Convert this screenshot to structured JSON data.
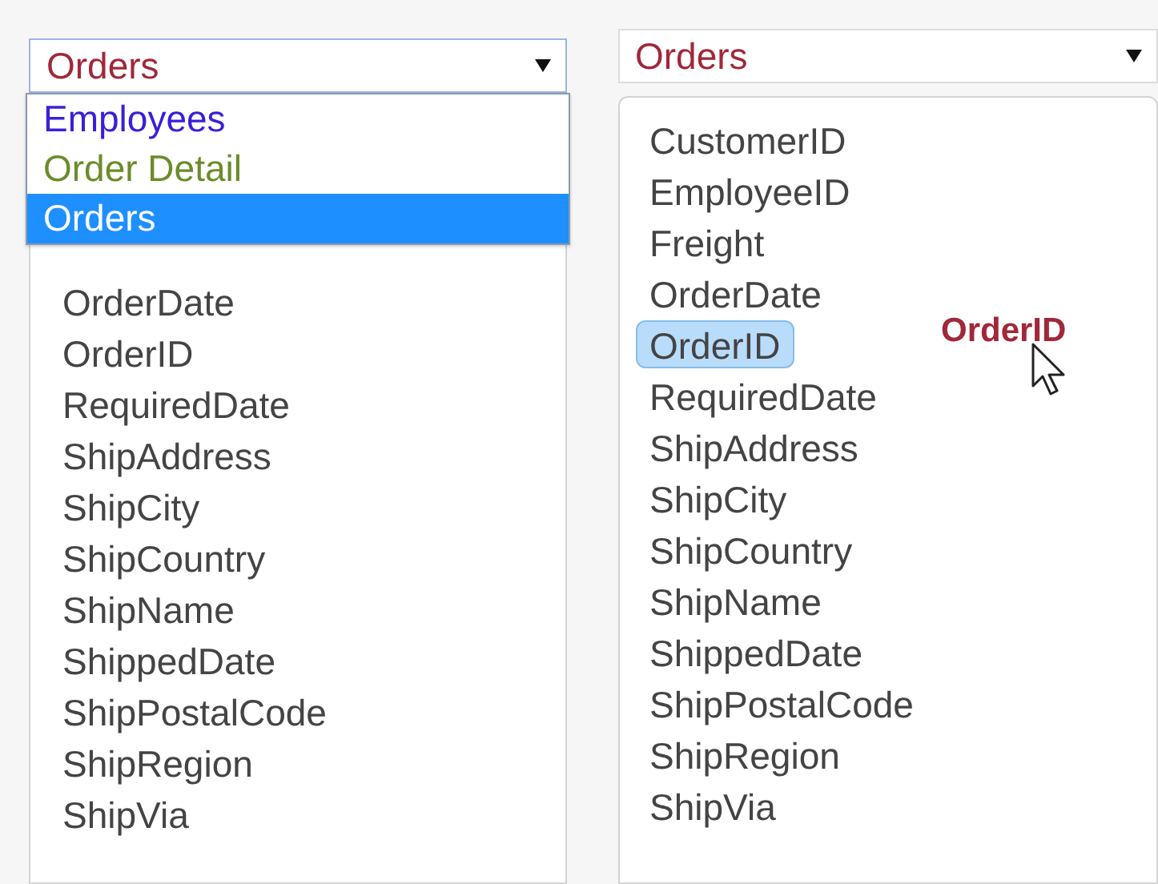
{
  "left_panel": {
    "select": {
      "value": "Orders",
      "expanded": true,
      "options": [
        {
          "label": "Employees",
          "color": "#3a1fd8",
          "selected": false
        },
        {
          "label": "Order Detail",
          "color": "#6b8c2a",
          "selected": false
        },
        {
          "label": "Orders",
          "selected": true
        }
      ]
    },
    "fields": [
      {
        "label": "OrderDate",
        "selected": false
      },
      {
        "label": "OrderID",
        "selected": false
      },
      {
        "label": "RequiredDate",
        "selected": false
      },
      {
        "label": "ShipAddress",
        "selected": false
      },
      {
        "label": "ShipCity",
        "selected": false
      },
      {
        "label": "ShipCountry",
        "selected": false
      },
      {
        "label": "ShipName",
        "selected": false
      },
      {
        "label": "ShippedDate",
        "selected": false
      },
      {
        "label": "ShipPostalCode",
        "selected": false
      },
      {
        "label": "ShipRegion",
        "selected": false
      },
      {
        "label": "ShipVia",
        "selected": false
      }
    ]
  },
  "right_panel": {
    "select": {
      "value": "Orders",
      "expanded": false
    },
    "fields": [
      {
        "label": "CustomerID",
        "selected": false
      },
      {
        "label": "EmployeeID",
        "selected": false
      },
      {
        "label": "Freight",
        "selected": false
      },
      {
        "label": "OrderDate",
        "selected": false
      },
      {
        "label": "OrderID",
        "selected": true
      },
      {
        "label": "RequiredDate",
        "selected": false
      },
      {
        "label": "ShipAddress",
        "selected": false
      },
      {
        "label": "ShipCity",
        "selected": false
      },
      {
        "label": "ShipCountry",
        "selected": false
      },
      {
        "label": "ShipName",
        "selected": false
      },
      {
        "label": "ShippedDate",
        "selected": false
      },
      {
        "label": "ShipPostalCode",
        "selected": false
      },
      {
        "label": "ShipRegion",
        "selected": false
      },
      {
        "label": "ShipVia",
        "selected": false
      }
    ],
    "drag_label": "OrderID"
  }
}
